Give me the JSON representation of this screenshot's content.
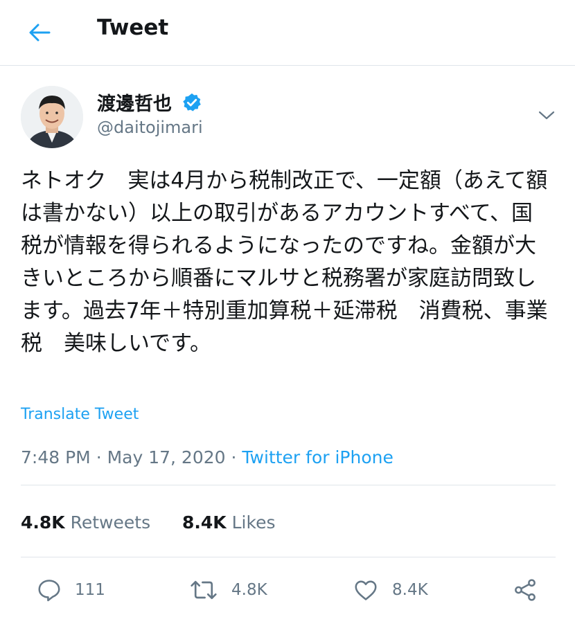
{
  "header": {
    "title": "Tweet"
  },
  "author": {
    "name": "渡邊哲也",
    "handle": "@daitojimari",
    "verified": true
  },
  "tweet": {
    "text": "ネトオク　実は4月から税制改正で、一定額（あえて額は書かない）以上の取引があるアカウントすべて、国税が情報を得られるようになったのですね。金額が大きいところから順番にマルサと税務署が家庭訪問致します。過去7年＋特別重加算税＋延滞税　消費税、事業税　美味しいです。",
    "translate_label": "Translate Tweet",
    "time": "7:48 PM",
    "date": "May 17, 2020",
    "separator": "·",
    "source": "Twitter for iPhone"
  },
  "stats": {
    "retweets_count": "4.8K",
    "retweets_label": "Retweets",
    "likes_count": "8.4K",
    "likes_label": "Likes"
  },
  "actions": {
    "reply_count": "111",
    "retweet_count": "4.8K",
    "like_count": "8.4K"
  },
  "colors": {
    "accent": "#1da1f2",
    "secondary_text": "#657786",
    "divider": "#dfe5ea"
  },
  "icons": [
    "back-arrow-icon",
    "verified-badge-icon",
    "chevron-down-icon",
    "reply-icon",
    "retweet-icon",
    "like-icon",
    "share-icon"
  ]
}
